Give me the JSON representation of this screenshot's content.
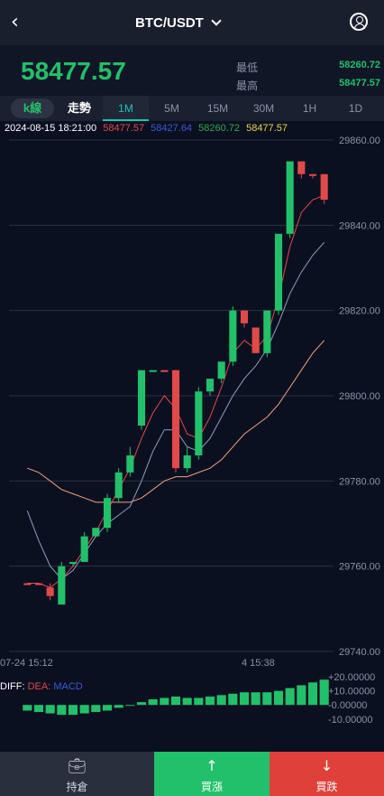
{
  "header": {
    "back_icon": "chevron-left-icon",
    "title": "BTC/USDT",
    "dropdown_icon": "chevron-down-icon",
    "user_icon": "user-circle-icon"
  },
  "price": {
    "last": "58477.57",
    "low_label": "最低",
    "low_value": "58260.72",
    "high_label": "最高",
    "high_value": "58477.57",
    "color": "#22c06a"
  },
  "tabs": {
    "kline": "k線",
    "trend": "走勢",
    "intervals": [
      "1M",
      "5M",
      "15M",
      "30M",
      "1H",
      "1D"
    ],
    "active": "1M"
  },
  "ohlc": {
    "time": "2024-08-15 18:21:00",
    "open": "58477.57",
    "high": "58427.64",
    "low": "58260.72",
    "close": "58477.57"
  },
  "chart_data": {
    "type": "candlestick",
    "y_ticks": [
      "29860.00",
      "29840.00",
      "29820.00",
      "29800.00",
      "29780.00",
      "29760.00",
      "29740.00"
    ],
    "ylim": [
      29740,
      29860
    ],
    "x_labels": [
      "07-24 15:12",
      "4 15:38"
    ],
    "candles": [
      {
        "o": 29756,
        "c": 29756,
        "h": 29756,
        "l": 29756,
        "up": false
      },
      {
        "o": 29756,
        "c": 29756,
        "h": 29756,
        "l": 29756,
        "up": false
      },
      {
        "o": 29755,
        "c": 29753,
        "h": 29756,
        "l": 29752,
        "up": false
      },
      {
        "o": 29751,
        "c": 29760,
        "h": 29761,
        "l": 29751,
        "up": true
      },
      {
        "o": 29761,
        "c": 29761,
        "h": 29761,
        "l": 29760,
        "up": true
      },
      {
        "o": 29761,
        "c": 29767,
        "h": 29768,
        "l": 29761,
        "up": true
      },
      {
        "o": 29767,
        "c": 29769,
        "h": 29769,
        "l": 29767,
        "up": true
      },
      {
        "o": 29769,
        "c": 29776,
        "h": 29777,
        "l": 29768,
        "up": true
      },
      {
        "o": 29776,
        "c": 29782,
        "h": 29783,
        "l": 29775,
        "up": true
      },
      {
        "o": 29782,
        "c": 29786,
        "h": 29788,
        "l": 29781,
        "up": true
      },
      {
        "o": 29793,
        "c": 29806,
        "h": 29806,
        "l": 29792,
        "up": true
      },
      {
        "o": 29806,
        "c": 29806,
        "h": 29806,
        "l": 29806,
        "up": true
      },
      {
        "o": 29806,
        "c": 29806,
        "h": 29806,
        "l": 29806,
        "up": false
      },
      {
        "o": 29806,
        "c": 29783,
        "h": 29806,
        "l": 29782,
        "up": false
      },
      {
        "o": 29783,
        "c": 29786,
        "h": 29788,
        "l": 29782,
        "up": true
      },
      {
        "o": 29786,
        "c": 29801,
        "h": 29802,
        "l": 29785,
        "up": true
      },
      {
        "o": 29801,
        "c": 29804,
        "h": 29804,
        "l": 29800,
        "up": true
      },
      {
        "o": 29804,
        "c": 29808,
        "h": 29808,
        "l": 29803,
        "up": true
      },
      {
        "o": 29808,
        "c": 29820,
        "h": 29821,
        "l": 29807,
        "up": true
      },
      {
        "o": 29820,
        "c": 29817,
        "h": 29820,
        "l": 29816,
        "up": false
      },
      {
        "o": 29816,
        "c": 29810,
        "h": 29816,
        "l": 29810,
        "up": false
      },
      {
        "o": 29810,
        "c": 29820,
        "h": 29820,
        "l": 29809,
        "up": true
      },
      {
        "o": 29820,
        "c": 29838,
        "h": 29838,
        "l": 29819,
        "up": true
      },
      {
        "o": 29838,
        "c": 29855,
        "h": 29855,
        "l": 29837,
        "up": true
      },
      {
        "o": 29855,
        "c": 29852,
        "h": 29855,
        "l": 29851,
        "up": false
      },
      {
        "o": 29852,
        "c": 29852,
        "h": 29852,
        "l": 29851,
        "up": false
      },
      {
        "o": 29852,
        "c": 29846,
        "h": 29852,
        "l": 29845,
        "up": false
      }
    ],
    "series": [
      {
        "values": [
          29783,
          29782,
          29780,
          29778,
          29777,
          29776,
          29775,
          29775,
          29775,
          29775,
          29776,
          29778,
          29780,
          29781,
          29781,
          29782,
          29783,
          29785,
          29788,
          29791,
          29793,
          29795,
          29798,
          29802,
          29806,
          29810,
          29813
        ],
        "color": "#f0a080"
      },
      {
        "values": [
          29773,
          29766,
          29760,
          29757,
          29759,
          29763,
          29767,
          29770,
          29772,
          29774,
          29780,
          29787,
          29792,
          29792,
          29788,
          29787,
          29790,
          29795,
          29800,
          29804,
          29807,
          29811,
          29817,
          29824,
          29829,
          29833,
          29836
        ],
        "color": "#8da0c0"
      },
      {
        "values": [
          29756,
          29756,
          29755,
          29757,
          29760,
          29764,
          29768,
          29773,
          29778,
          29783,
          29790,
          29796,
          29800,
          29797,
          29791,
          29790,
          29795,
          29802,
          29810,
          29813,
          29811,
          29814,
          29823,
          29835,
          29843,
          29846,
          29847
        ],
        "color": "#e04a4a"
      }
    ],
    "macd": {
      "head": "DIFF:",
      "dea": "DEA:",
      "macd": "MACD",
      "ticks": [
        "+20.00000",
        "+10.00000",
        "-0.00000",
        "-10.00000"
      ],
      "ylim": [
        -14,
        22
      ],
      "bars": [
        -4,
        -5,
        -6,
        -7,
        -7,
        -6,
        -5,
        -4,
        -2,
        0,
        2,
        4,
        5,
        6,
        5,
        5,
        6,
        7,
        8,
        9,
        9,
        9,
        10,
        12,
        14,
        16,
        18
      ]
    }
  },
  "bottom": {
    "position_label": "持倉",
    "position_icon": "wallet-icon",
    "buy_label": "買漲",
    "buy_icon": "upload-arrow-icon",
    "sell_label": "買跌",
    "sell_icon": "download-arrow-icon"
  }
}
